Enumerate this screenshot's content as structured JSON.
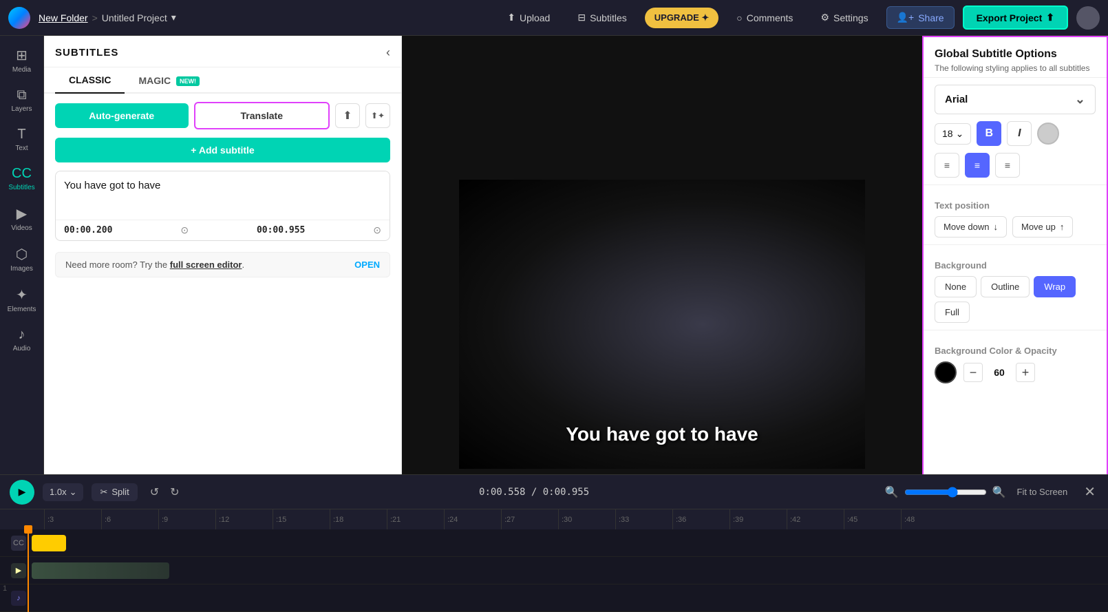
{
  "app": {
    "logo_alt": "Clipchamp logo"
  },
  "nav": {
    "folder": "New Folder",
    "sep": ">",
    "project": "Untitled Project",
    "caret": "▾",
    "upload": "Upload",
    "subtitles_nav": "Subtitles",
    "upgrade": "UPGRADE ✦",
    "comments": "Comments",
    "settings": "Settings",
    "share": "Share",
    "export": "Export Project",
    "export_icon": "⬆"
  },
  "sidebar": {
    "items": [
      {
        "id": "media",
        "label": "Media",
        "icon": "⊞"
      },
      {
        "id": "layers",
        "label": "Layers",
        "icon": "⧉"
      },
      {
        "id": "text",
        "label": "Text",
        "icon": "T"
      },
      {
        "id": "subtitles",
        "label": "Subtitles",
        "icon": "CC",
        "active": true
      },
      {
        "id": "videos",
        "label": "Videos",
        "icon": "▶"
      },
      {
        "id": "images",
        "label": "Images",
        "icon": "⬡"
      },
      {
        "id": "elements",
        "label": "Elements",
        "icon": "✦"
      },
      {
        "id": "audio",
        "label": "Audio",
        "icon": "♪"
      }
    ]
  },
  "subtitles_panel": {
    "title": "SUBTITLES",
    "tabs": [
      {
        "id": "classic",
        "label": "CLASSIC",
        "active": true
      },
      {
        "id": "magic",
        "label": "MAGIC",
        "badge": "NEW!"
      }
    ],
    "auto_generate": "Auto-generate",
    "translate": "Translate",
    "add_subtitle": "+ Add subtitle",
    "subtitle_text": "You have got to have",
    "timestamp_start": "00:00.200",
    "timestamp_end": "00:00.955",
    "more_room_text": "Need more room? Try the ",
    "full_screen_editor": "full screen editor",
    "more_room_suffix": ".",
    "open_btn": "OPEN"
  },
  "video": {
    "subtitle_text": "You have got to have"
  },
  "global_options": {
    "title": "Global Subtitle Options",
    "description": "The following styling applies to all subtitles",
    "font": "Arial",
    "font_size": "18",
    "text_position": "Text position",
    "move_down": "Move down",
    "move_up": "Move up",
    "background": "Background",
    "bg_none": "None",
    "bg_outline": "Outline",
    "bg_wrap": "Wrap",
    "bg_full": "Full",
    "bg_color_label": "Background Color & Opacity",
    "opacity_value": "60"
  },
  "playback": {
    "speed": "1.0x",
    "split": "Split",
    "timecode": "0:00.558 / 0:00.955",
    "fit_screen": "Fit to Screen"
  },
  "timeline": {
    "ruler_marks": [
      ":3",
      ":6",
      ":9",
      ":12",
      ":15",
      ":18",
      ":21",
      ":24",
      ":27",
      ":30",
      ":33",
      ":36",
      ":39",
      ":42",
      ":45",
      ":48"
    ]
  }
}
